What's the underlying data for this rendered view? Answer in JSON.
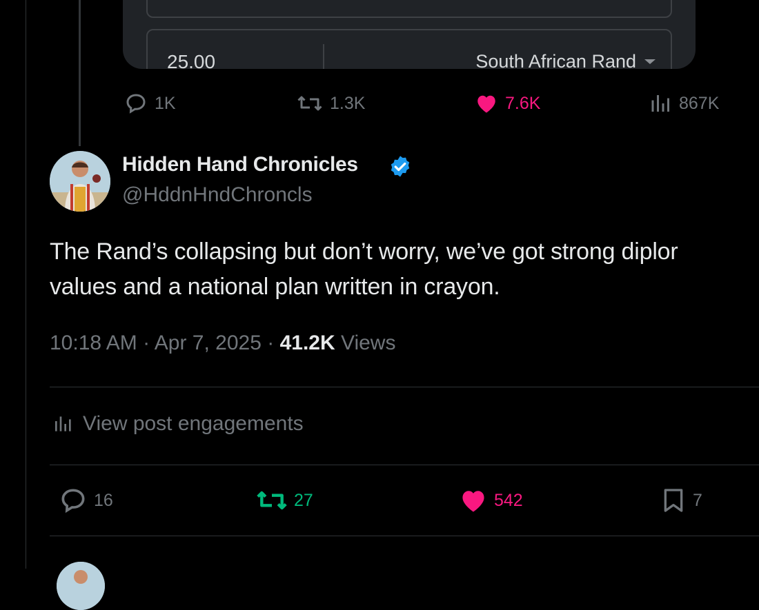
{
  "quoted_card": {
    "amount_value": "25.00",
    "currency_label": "South African Rand"
  },
  "parent_actions": {
    "replies": "1K",
    "reposts": "1.3K",
    "likes": "7.6K",
    "views": "867K"
  },
  "post": {
    "author_name": "Hidden Hand Chronicles",
    "author_handle": "@HddnHndChroncls",
    "text": "The Rand’s collapsing but don’t worry, we’ve got strong diplor\nvalues and a national plan written in crayon.",
    "time": "10:18 AM",
    "date": "Apr 7, 2025",
    "views_count": "41.2K",
    "views_label": "Views",
    "engagements_label": "View post engagements"
  },
  "post_actions": {
    "replies": "16",
    "reposts": "27",
    "likes": "542",
    "bookmarks": "7"
  },
  "colors": {
    "background": "#000000",
    "like_pink": "#f91880",
    "repost_green": "#00ba7c",
    "verified_blue": "#1d9bf0",
    "muted_text": "#71767b"
  }
}
